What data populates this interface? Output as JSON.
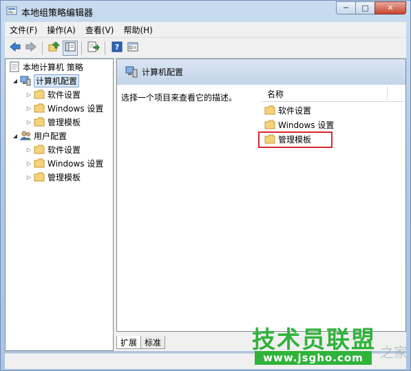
{
  "window": {
    "title": "本地组策略编辑器",
    "caption_buttons": [
      "─",
      "□",
      "✕"
    ]
  },
  "menu": [
    "文件(F)",
    "操作(A)",
    "查看(V)",
    "帮助(H)"
  ],
  "toolbar": {
    "icons": [
      "back-arrow-icon",
      "forward-arrow-icon",
      "up-folder-icon",
      "show-hide-tree-icon",
      "export-list-icon",
      "help-icon",
      "properties-icon"
    ],
    "pressed": "show-hide-tree-icon"
  },
  "tree": {
    "root": "本地计算机 策略",
    "computer_config": "计算机配置",
    "user_config": "用户配置",
    "computer_children": [
      "软件设置",
      "Windows 设置",
      "管理模板"
    ],
    "user_children": [
      "软件设置",
      "Windows 设置",
      "管理模板"
    ],
    "selected": "计算机配置"
  },
  "right_pane": {
    "header_title": "计算机配置",
    "description": "选择一个项目来查看它的描述。",
    "column_name": "名称",
    "items": [
      "软件设置",
      "Windows 设置",
      "管理模板"
    ],
    "highlighted_item": "管理模板"
  },
  "tabs": [
    "扩展",
    "标准"
  ],
  "active_tab": "扩展",
  "watermark": {
    "main": "技术员联盟",
    "tail": "之家",
    "url": "www.jsgho.com"
  },
  "colors": {
    "highlight_border": "#d9262d",
    "watermark_green": "#2fb33a",
    "folder_yellow": "#f5d27a"
  }
}
